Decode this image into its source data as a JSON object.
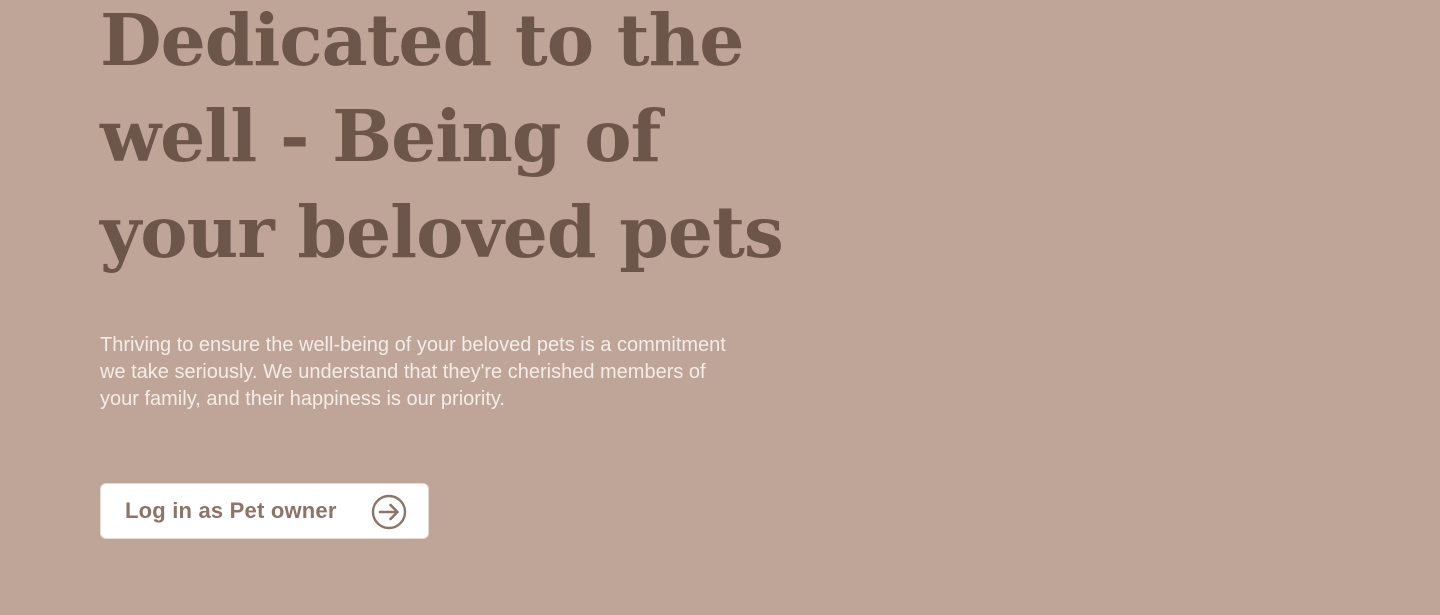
{
  "hero": {
    "title": "Dedicated to the well - Being of your beloved pets",
    "description": "Thriving to ensure the well-being of your beloved pets is a commitment we take seriously. We understand that they're cherished members of your family, and their happiness is our priority.",
    "cta_label": "Log in as Pet owner",
    "cta_icon": "arrow-right-circle-icon"
  },
  "colors": {
    "background": "#bea598",
    "title": "#6b5649",
    "description": "#f4ece7",
    "button_bg": "#ffffff",
    "button_text": "#8d7466"
  }
}
